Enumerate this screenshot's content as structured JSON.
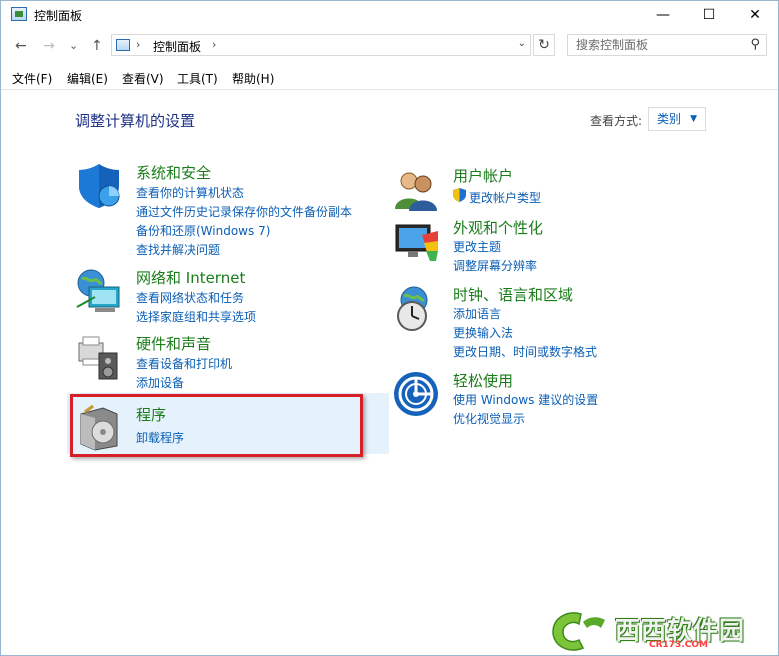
{
  "window": {
    "title": "控制面板",
    "controls": {
      "minimize": "—",
      "maximize": "☐",
      "close": "✕"
    }
  },
  "nav": {
    "back": "←",
    "forward": "→",
    "recent": "⌄",
    "up": "↑",
    "chevron": "›",
    "breadcrumb": "控制面板",
    "dropdown": "⌄",
    "refresh": "↻",
    "search_placeholder": "搜索控制面板",
    "search_glyph": "⚲"
  },
  "menu": {
    "file": "文件(F)",
    "edit": "编辑(E)",
    "view": "查看(V)",
    "tools": "工具(T)",
    "help": "帮助(H)"
  },
  "page": {
    "title": "调整计算机的设置",
    "view_by_label": "查看方式:",
    "view_by_value": "类别",
    "view_by_caret": "▼"
  },
  "categories": {
    "system_security": {
      "title": "系统和安全",
      "links": [
        "查看你的计算机状态",
        "通过文件历史记录保存你的文件备份副本",
        "备份和还原(Windows 7)",
        "查找并解决问题"
      ]
    },
    "network": {
      "title": "网络和 Internet",
      "links": [
        "查看网络状态和任务",
        "选择家庭组和共享选项"
      ]
    },
    "hardware": {
      "title": "硬件和声音",
      "links": [
        "查看设备和打印机",
        "添加设备"
      ]
    },
    "programs": {
      "title": "程序",
      "links": [
        "卸载程序"
      ]
    },
    "user_accounts": {
      "title": "用户帐户",
      "links": [
        "更改帐户类型"
      ]
    },
    "appearance": {
      "title": "外观和个性化",
      "links": [
        "更改主题",
        "调整屏幕分辨率"
      ]
    },
    "clock": {
      "title": "时钟、语言和区域",
      "links": [
        "添加语言",
        "更换输入法",
        "更改日期、时间或数字格式"
      ]
    },
    "ease": {
      "title": "轻松使用",
      "links": [
        "使用 Windows 建议的设置",
        "优化视觉显示"
      ]
    }
  },
  "watermark": {
    "text": "西西软件园",
    "sub": "CR173.COM"
  },
  "colors": {
    "category_title": "#1a7c1a",
    "link": "#0b5fb6",
    "page_title": "#1e3287",
    "highlight": "#e5f1fb",
    "annotation_box": "#d61f26"
  }
}
